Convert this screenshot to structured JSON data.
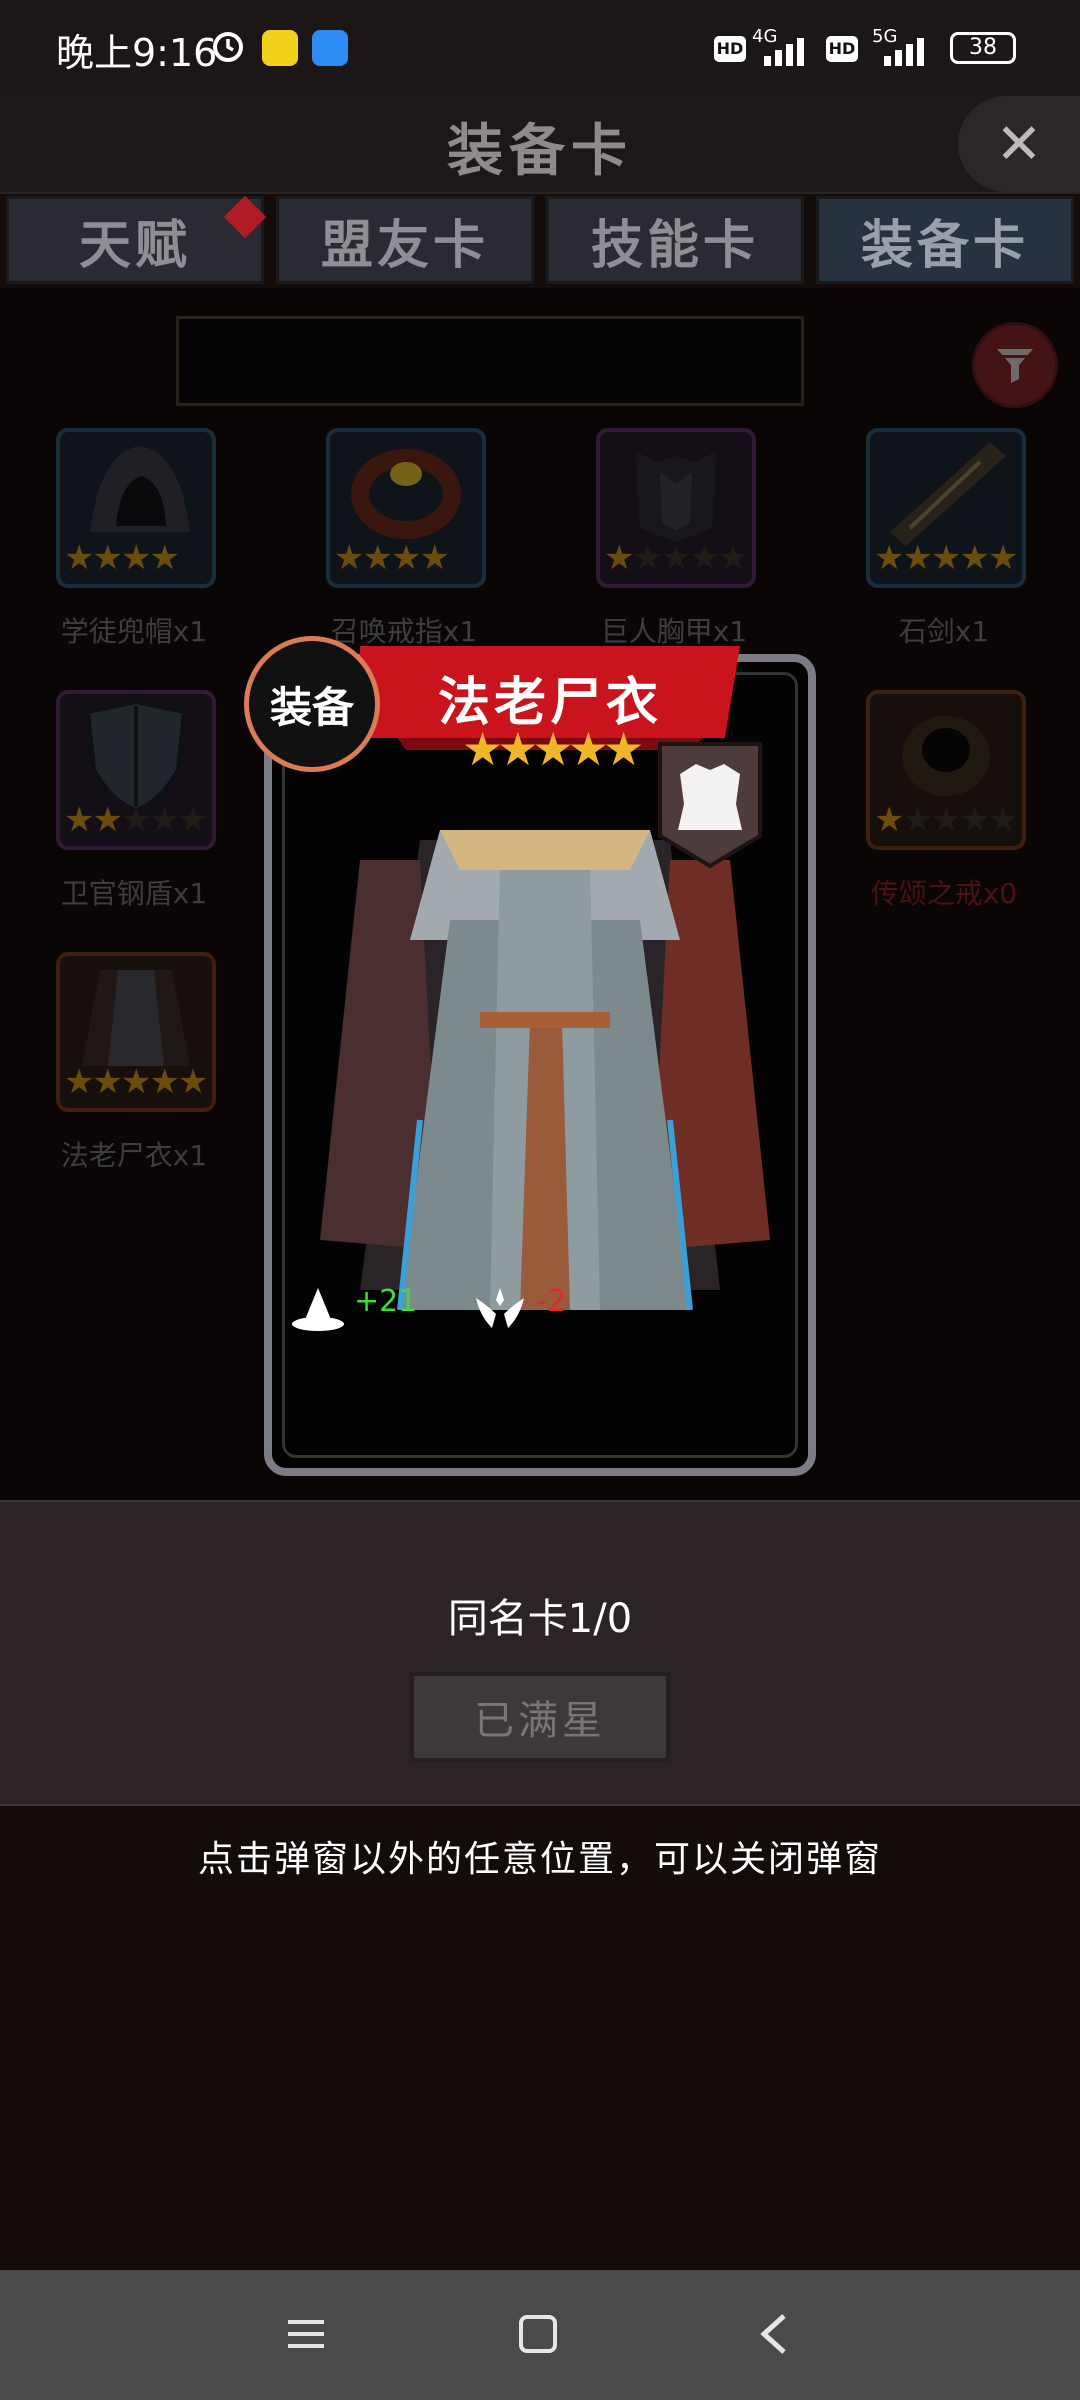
{
  "status_bar": {
    "time": "晚上9:16",
    "network1": "4G",
    "hd1": "HD",
    "network2": "5G",
    "hd2": "HD",
    "battery": "38"
  },
  "header": {
    "title": "装备卡",
    "close_icon": "close-icon"
  },
  "tabs": [
    {
      "label": "天赋",
      "badge": true
    },
    {
      "label": "盟友卡"
    },
    {
      "label": "技能卡"
    },
    {
      "label": "装备卡",
      "active": true
    }
  ],
  "search": {
    "value": ""
  },
  "items": [
    {
      "name": "学徒兜帽x1",
      "stars": 4,
      "frame": "blue"
    },
    {
      "name": "召唤戒指x1",
      "stars": 4,
      "frame": "blue"
    },
    {
      "name": "巨人胸甲x1",
      "stars": 1,
      "frame": "purple"
    },
    {
      "name": "石剑x1",
      "stars": 5,
      "frame": "blue"
    },
    {
      "name": "卫官钢盾x1",
      "stars": 2,
      "frame": "purple"
    },
    {
      "name": "传颂之戒x0",
      "stars": 1,
      "frame": "orange",
      "missing": true
    },
    {
      "name": "法老尸衣x1",
      "stars": 5,
      "frame": "orange"
    }
  ],
  "card": {
    "type_badge": "装备",
    "name": "法老尸衣",
    "stars": "★★★★★",
    "stat1_value": "+21",
    "stat2_value": "-2",
    "colors": {
      "stat1": "#3ddc3d",
      "stat2": "#e02a2a",
      "banner": "#c9141e"
    }
  },
  "info": {
    "same_card": "同名卡1/0",
    "max_button": "已满星",
    "hint": "点击弹窗以外的任意位置，可以关闭弹窗"
  }
}
